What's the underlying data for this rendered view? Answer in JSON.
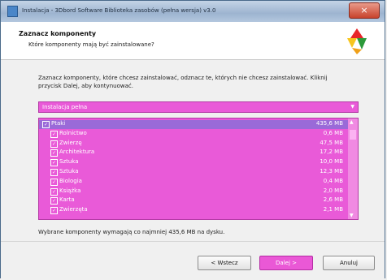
{
  "window": {
    "title": "Instalacja - 3Dbord Software Biblioteka zasobów (pełna wersja) v3.0",
    "close_label": "×"
  },
  "header": {
    "title": "Zaznacz komponenty",
    "subtitle": "Które komponenty mają być zainstalowane?"
  },
  "description": "Zaznacz komponenty, które chcesz zainstalować, odznacz te, których nie chcesz zainstalować. Kliknij przycisk Dalej, aby kontynuować.",
  "installation_type": {
    "selected": "Instalacja pełna",
    "arrow": "▼"
  },
  "components": [
    {
      "label": "Ptaki",
      "size": "435,6 MB",
      "checked": true,
      "selected": true,
      "indent": 0
    },
    {
      "label": "Rolnictwo",
      "size": "0,6 MB",
      "checked": true,
      "selected": false,
      "indent": 1
    },
    {
      "label": "Zwierzę",
      "size": "47,5 MB",
      "checked": true,
      "selected": false,
      "indent": 1
    },
    {
      "label": "Architektura",
      "size": "17,2 MB",
      "checked": true,
      "selected": false,
      "indent": 1
    },
    {
      "label": "Sztuka",
      "size": "10,0 MB",
      "checked": true,
      "selected": false,
      "indent": 1
    },
    {
      "label": "Sztuka",
      "size": "12,3 MB",
      "checked": true,
      "selected": false,
      "indent": 1
    },
    {
      "label": "Biologia",
      "size": "0,4 MB",
      "checked": true,
      "selected": false,
      "indent": 1
    },
    {
      "label": "Książka",
      "size": "2,0 MB",
      "checked": true,
      "selected": false,
      "indent": 1
    },
    {
      "label": "Karta",
      "size": "2,6 MB",
      "checked": true,
      "selected": false,
      "indent": 1
    },
    {
      "label": "Zwierzęta",
      "size": "2,1 MB",
      "checked": true,
      "selected": false,
      "indent": 1
    }
  ],
  "scroll": {
    "up": "▲",
    "down": "▼"
  },
  "space_required": "Wybrane komponenty wymagają co najmniej 435,6 MB na dysku.",
  "buttons": {
    "back": "< Wstecz",
    "next": "Dalej >",
    "cancel": "Anuluj"
  },
  "colors": {
    "highlight": "#e95ad8",
    "selected_row": "#9a6ad8"
  }
}
